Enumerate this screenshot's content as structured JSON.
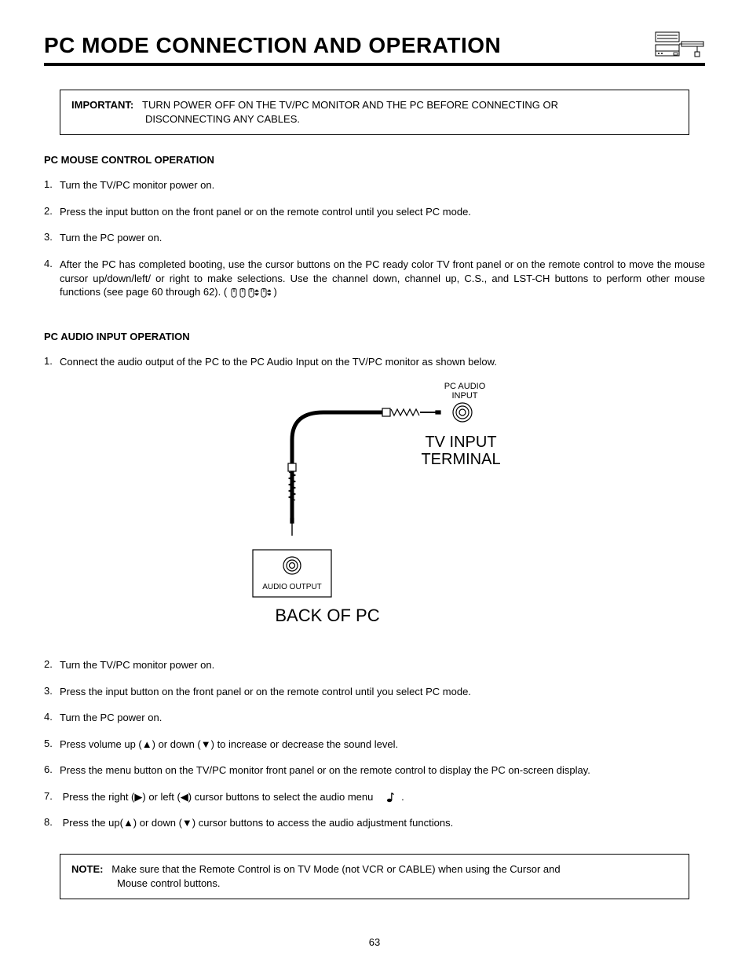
{
  "header": {
    "title": "PC MODE CONNECTION AND OPERATION"
  },
  "important_box": {
    "label": "IMPORTANT:",
    "text_line1": "TURN POWER OFF ON THE TV/PC MONITOR AND THE PC BEFORE CONNECTING OR",
    "text_line2": "DISCONNECTING ANY CABLES."
  },
  "section1": {
    "heading": "PC MOUSE CONTROL OPERATION",
    "steps": [
      "Turn the TV/PC monitor power on.",
      "Press the input button on the front panel or on the remote control until you select PC mode.",
      "Turn the PC power on.",
      "After the PC has completed booting, use the cursor buttons on the PC ready color TV front panel or on the remote control to move the mouse cursor up/down/left/ or right to make selections. Use the channel down, channel up, C.S., and LST-CH buttons to perform other mouse functions (see page 60 through 62). ("
    ],
    "step4_tail": ")"
  },
  "section2": {
    "heading": "PC AUDIO INPUT OPERATION",
    "step1": "Connect the audio output of the PC to the PC Audio Input on the TV/PC monitor as shown below.",
    "steps_after": [
      "Turn the TV/PC monitor power on.",
      "Press the input button on the front panel or on the remote control until you select PC mode.",
      "Turn the PC power on.",
      "Press volume up (▲) or down (▼) to increase or decrease the sound level.",
      "Press the menu button on the TV/PC monitor front panel or on the remote control to display the PC on-screen display.",
      "Press the right (▶) or left (◀) cursor buttons to select the audio menu",
      "Press the up(▲) or down (▼) cursor buttons to access the audio adjustment functions."
    ],
    "step7_tail": "."
  },
  "diagram": {
    "pc_audio_line1": "PC AUDIO",
    "pc_audio_line2": "INPUT",
    "tv_input_line1": "TV INPUT",
    "tv_input_line2": "TERMINAL",
    "audio_output": "AUDIO OUTPUT",
    "back_of_pc": "BACK OF PC"
  },
  "note_box": {
    "label": "NOTE:",
    "text_line1": "Make sure that the Remote Control is on TV Mode (not VCR or CABLE) when using the Cursor and",
    "text_line2": "Mouse control buttons."
  },
  "page_number": "63"
}
